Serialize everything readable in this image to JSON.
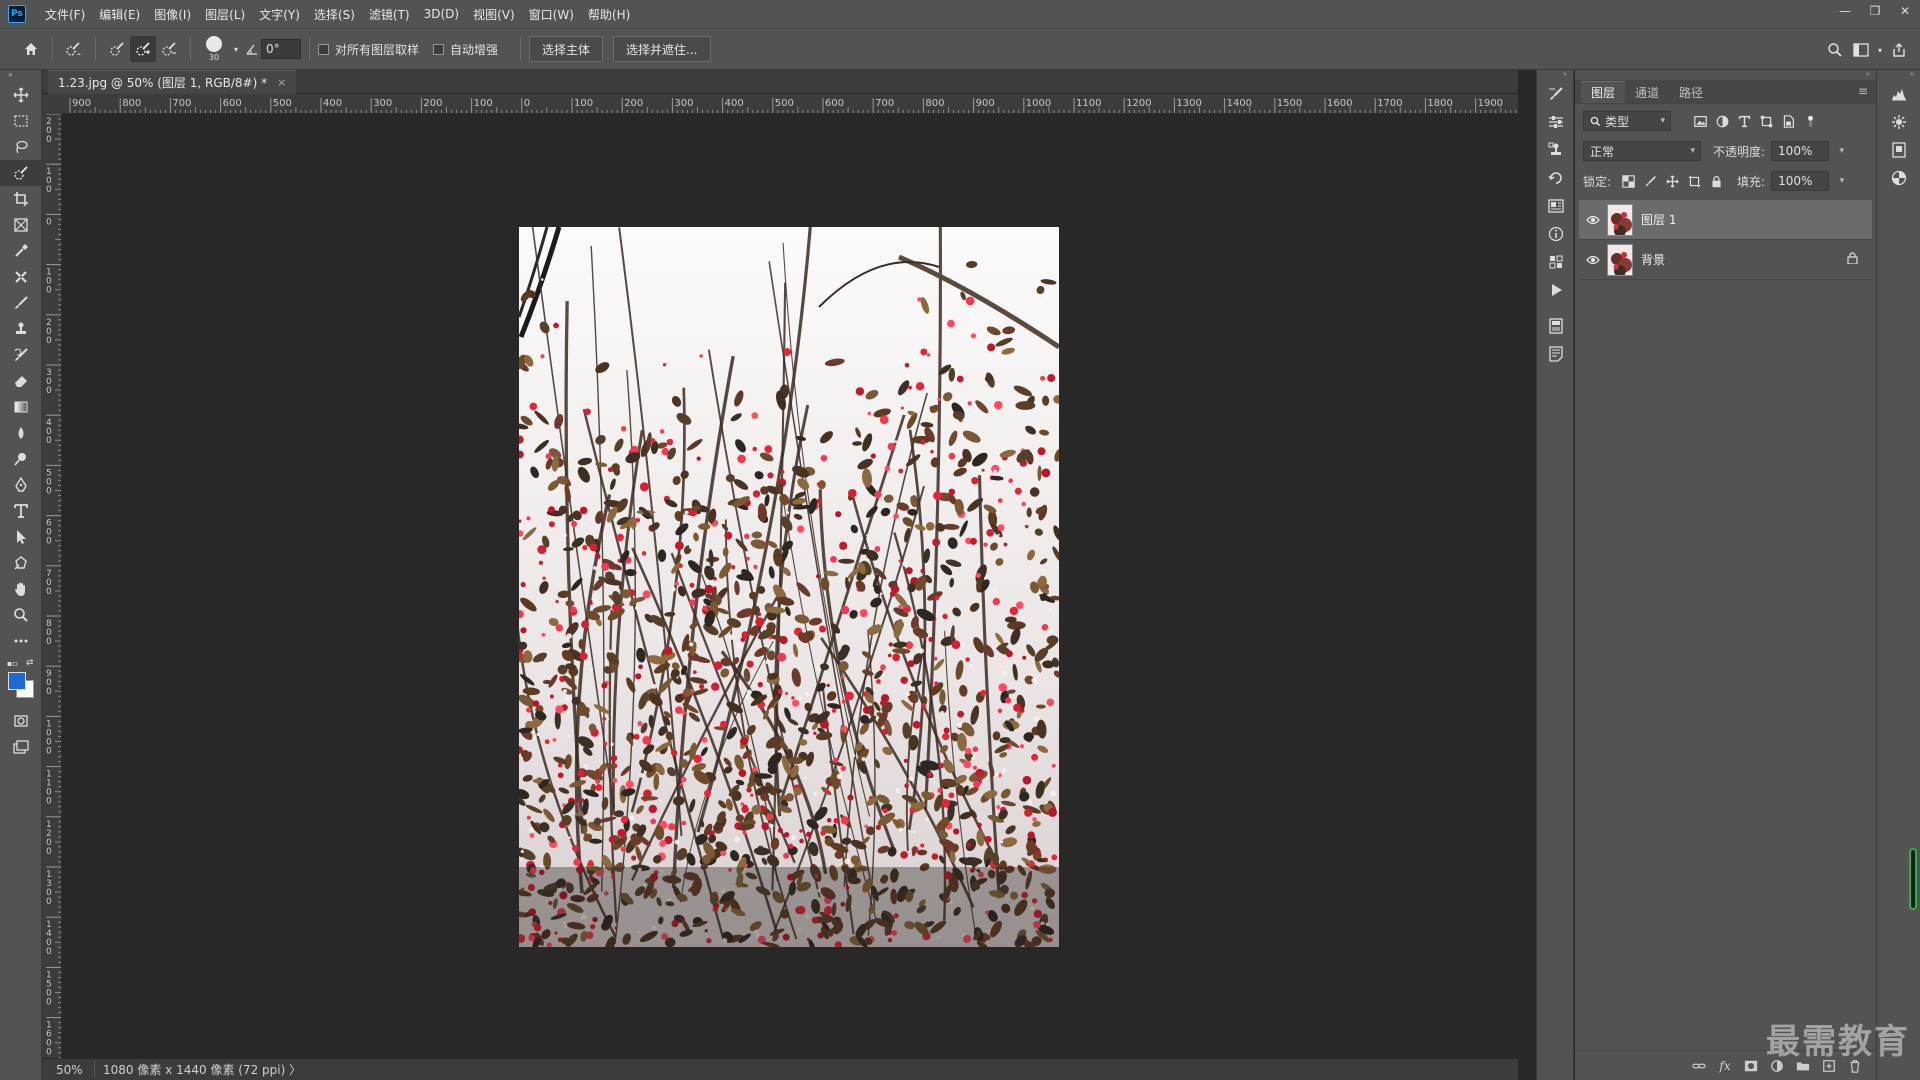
{
  "app": {
    "logo": "Ps",
    "menu": [
      "文件(F)",
      "编辑(E)",
      "图像(I)",
      "图层(L)",
      "文字(Y)",
      "选择(S)",
      "滤镜(T)",
      "3D(D)",
      "视图(V)",
      "窗口(W)",
      "帮助(H)"
    ],
    "window_controls": [
      "—",
      "❐",
      "✕"
    ]
  },
  "options_bar": {
    "brush_size": "30",
    "angle": "0°",
    "sample_all_layers": "对所有图层取样",
    "auto_enhance": "自动增强",
    "select_subject": "选择主体",
    "select_and_mask": "选择并遮住..."
  },
  "document": {
    "tab_title": "1.23.jpg @ 50% (图层 1, RGB/8#) *",
    "tab_close": "×",
    "accent": "#e8243a"
  },
  "rulers": {
    "horizontal": [
      "900",
      "800",
      "700",
      "600",
      "500",
      "400",
      "300",
      "200",
      "100",
      "0",
      "100",
      "200",
      "300",
      "400",
      "500",
      "600",
      "700",
      "800",
      "900",
      "1000",
      "1100",
      "1200",
      "1300",
      "1400",
      "1500",
      "1600",
      "1700",
      "1800",
      "1900"
    ],
    "vertical": [
      "200",
      "100",
      "0",
      "100",
      "200",
      "300",
      "400",
      "500",
      "600",
      "700",
      "800",
      "900",
      "1000",
      "1100",
      "1200",
      "1300",
      "1400",
      "1500",
      "1600"
    ]
  },
  "status": {
    "zoom": "50%",
    "info": "1080 像素 x 1440 像素 (72 ppi)",
    "arrow": "〉"
  },
  "toolbar": {
    "collapse": "»",
    "tools": [
      "move-tool",
      "marquee-tool",
      "lasso-tool",
      "quick-selection-tool",
      "crop-tool",
      "frame-tool",
      "eyedropper-tool",
      "healing-tool",
      "brush-tool",
      "stamp-tool",
      "history-brush-tool",
      "eraser-tool",
      "gradient-tool",
      "blur-tool",
      "dodge-tool",
      "pen-tool",
      "type-tool",
      "path-selection-tool",
      "shape-tool",
      "hand-tool",
      "zoom-tool",
      "more-tools",
      "quick-mask",
      "screen-mode"
    ],
    "fg_color": "#1e6ad4",
    "bg_color": "#ffffff"
  },
  "layers_panel": {
    "tabs": [
      "图层",
      "通道",
      "路径"
    ],
    "active_tab": "图层",
    "filter_kind": "类型",
    "blend_mode": "正常",
    "opacity_label": "不透明度:",
    "opacity_value": "100%",
    "lock_label": "锁定:",
    "fill_label": "填充:",
    "fill_value": "100%",
    "layers": [
      {
        "name": "图层 1",
        "selected": true,
        "locked": false
      },
      {
        "name": "背景",
        "selected": false,
        "locked": true
      }
    ]
  },
  "watermark": "最需教育"
}
